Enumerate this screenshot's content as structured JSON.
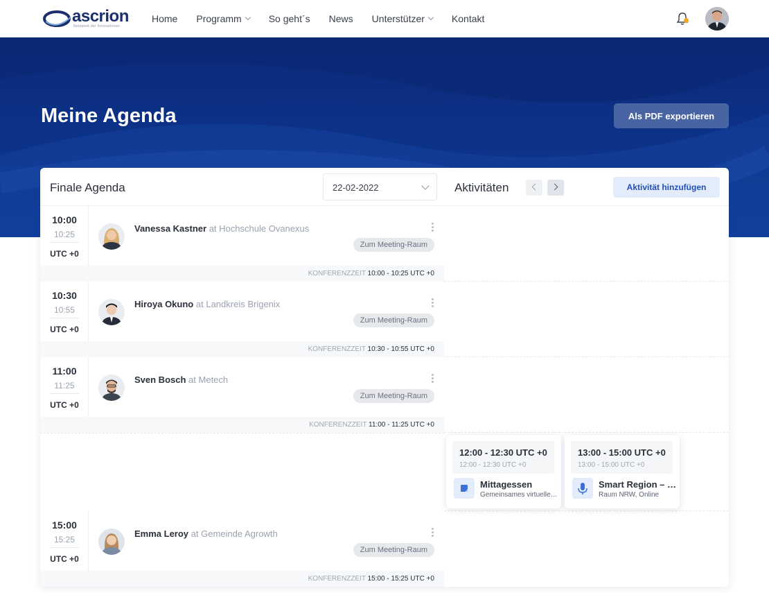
{
  "header": {
    "logo_text": "ascrion",
    "logo_sub": "Netzwerk der Innovationen",
    "nav": [
      {
        "label": "Home",
        "has_dropdown": false
      },
      {
        "label": "Programm",
        "has_dropdown": true
      },
      {
        "label": "So geht´s",
        "has_dropdown": false
      },
      {
        "label": "News",
        "has_dropdown": false
      },
      {
        "label": "Unterstützer",
        "has_dropdown": true
      },
      {
        "label": "Kontakt",
        "has_dropdown": false
      }
    ],
    "notification_icon": "bell-icon",
    "notification_dot_color": "#f5a623"
  },
  "hero": {
    "title": "Meine Agenda",
    "export_button": "Als PDF exportieren"
  },
  "agenda": {
    "title": "Finale Agenda",
    "date": "22-02-2022",
    "activities_title": "Aktivitäten",
    "add_activity_button": "Aktivität hinzufügen",
    "slots": [
      {
        "start": "10:00",
        "end": "10:25",
        "tz": "UTC +0",
        "name": "Vanessa Kastner",
        "at": "at",
        "org": "Hochschule Ovanexus",
        "tag": "Zum Meeting-Raum",
        "conf_label": "Konferenzzeit",
        "conf_time": "10:00 - 10:25 UTC +0"
      },
      {
        "start": "10:30",
        "end": "10:55",
        "tz": "UTC +0",
        "name": "Hiroya Okuno",
        "at": "at",
        "org": "Landkreis Brigenix",
        "tag": "Zum Meeting-Raum",
        "conf_label": "Konferenzzeit",
        "conf_time": "10:30 - 10:55 UTC +0"
      },
      {
        "start": "11:00",
        "end": "11:25",
        "tz": "UTC +0",
        "name": "Sven Bosch",
        "at": "at",
        "org": "Metech",
        "tag": "Zum Meeting-Raum",
        "conf_label": "Konferenzzeit",
        "conf_time": "11:00 - 11:25 UTC +0"
      },
      {
        "start": "15:00",
        "end": "15:25",
        "tz": "UTC +0",
        "name": "Emma Leroy",
        "at": "at",
        "org": "Gemeinde Agrowth",
        "tag": "Zum Meeting-Raum",
        "conf_label": "Konferenzzeit",
        "conf_time": "15:00 - 15:25 UTC +0"
      }
    ],
    "activities": [
      {
        "time": "12:00 - 12:30 UTC +0",
        "time_sub": "12:00 - 12:30 UTC +0",
        "name": "Mittagessen",
        "sub": "Gemeinsames virtuelles Mittagessen",
        "icon": "note-icon"
      },
      {
        "time": "13:00 - 15:00 UTC +0",
        "time_sub": "13:00 - 15:00 UTC +0",
        "name": "Smart Region – NRW",
        "sub": "Raum NRW, Online",
        "icon": "microphone-icon"
      }
    ]
  }
}
